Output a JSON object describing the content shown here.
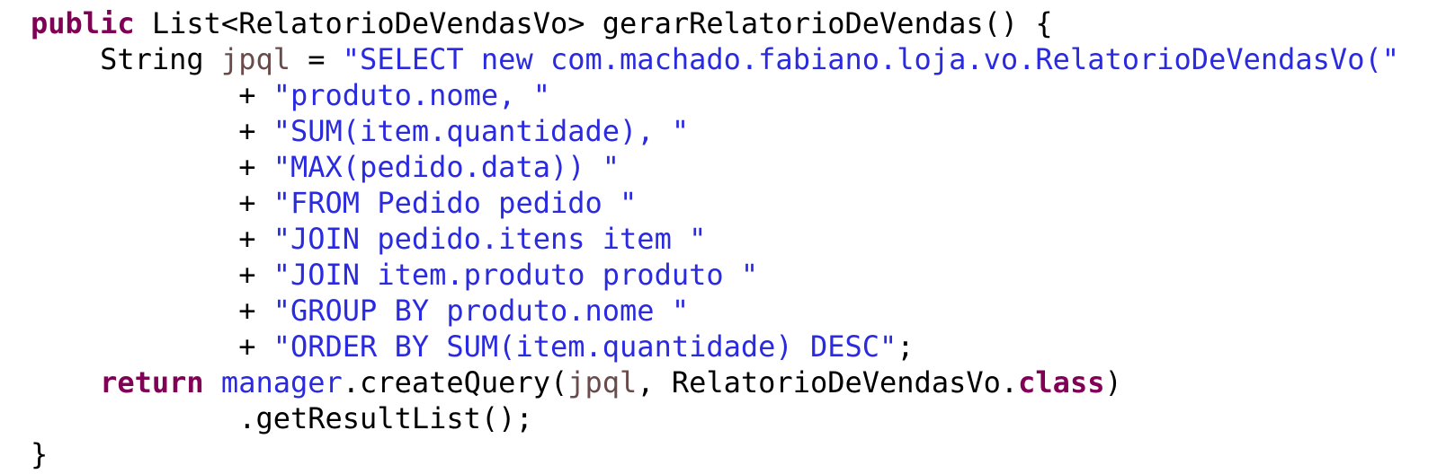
{
  "editor": {
    "language": "Java",
    "background_color": "#FFFFFF",
    "font_family_kind": "monospace",
    "colors": {
      "plain": "#000000",
      "keyword": "#7F0055",
      "string": "#2A2AE0",
      "local_variable": "#6A4A4A",
      "field": "#2A2AE0",
      "operator": "#000000"
    }
  },
  "code": {
    "full_text": "public List<RelatorioDeVendasVo> gerarRelatorioDeVendas() {\n    String jpql = \"SELECT new com.machado.fabiano.loja.vo.RelatorioDeVendasVo(\"\n            + \"produto.nome, \"\n            + \"SUM(item.quantidade), \"\n            + \"MAX(pedido.data)) \"\n            + \"FROM Pedido pedido \"\n            + \"JOIN pedido.itens item \"\n            + \"JOIN item.produto produto \"\n            + \"GROUP BY produto.nome \"\n            + \"ORDER BY SUM(item.quantidade) DESC\";\n    return manager.createQuery(jpql, RelatorioDeVendasVo.class)\n            .getResultList();\n}",
    "lines": [
      {
        "index": 1,
        "tokens": [
          {
            "t": "public",
            "c": "keyword"
          },
          {
            "t": " List<RelatorioDeVendasVo> gerarRelatorioDeVendas() {",
            "c": "plain"
          }
        ]
      },
      {
        "index": 2,
        "tokens": [
          {
            "t": "    String ",
            "c": "plain"
          },
          {
            "t": "jpql",
            "c": "local"
          },
          {
            "t": " = ",
            "c": "plain"
          },
          {
            "t": "\"SELECT new com.machado.fabiano.loja.vo.RelatorioDeVendasVo(\"",
            "c": "string"
          }
        ]
      },
      {
        "index": 3,
        "tokens": [
          {
            "t": "            + ",
            "c": "op"
          },
          {
            "t": "\"produto.nome, \"",
            "c": "string"
          }
        ]
      },
      {
        "index": 4,
        "tokens": [
          {
            "t": "            + ",
            "c": "op"
          },
          {
            "t": "\"SUM(item.quantidade), \"",
            "c": "string"
          }
        ]
      },
      {
        "index": 5,
        "tokens": [
          {
            "t": "            + ",
            "c": "op"
          },
          {
            "t": "\"MAX(pedido.data)) \"",
            "c": "string"
          }
        ]
      },
      {
        "index": 6,
        "tokens": [
          {
            "t": "            + ",
            "c": "op"
          },
          {
            "t": "\"FROM Pedido pedido \"",
            "c": "string"
          }
        ]
      },
      {
        "index": 7,
        "tokens": [
          {
            "t": "            + ",
            "c": "op"
          },
          {
            "t": "\"JOIN pedido.itens item \"",
            "c": "string"
          }
        ]
      },
      {
        "index": 8,
        "tokens": [
          {
            "t": "            + ",
            "c": "op"
          },
          {
            "t": "\"JOIN item.produto produto \"",
            "c": "string"
          }
        ]
      },
      {
        "index": 9,
        "tokens": [
          {
            "t": "            + ",
            "c": "op"
          },
          {
            "t": "\"GROUP BY produto.nome \"",
            "c": "string"
          }
        ]
      },
      {
        "index": 10,
        "tokens": [
          {
            "t": "            + ",
            "c": "op"
          },
          {
            "t": "\"ORDER BY SUM(item.quantidade) DESC\"",
            "c": "string"
          },
          {
            "t": ";",
            "c": "plain"
          }
        ]
      },
      {
        "index": 11,
        "tokens": [
          {
            "t": "    ",
            "c": "plain"
          },
          {
            "t": "return",
            "c": "keyword"
          },
          {
            "t": " ",
            "c": "plain"
          },
          {
            "t": "manager",
            "c": "field"
          },
          {
            "t": ".createQuery(",
            "c": "plain"
          },
          {
            "t": "jpql",
            "c": "local"
          },
          {
            "t": ", RelatorioDeVendasVo.",
            "c": "plain"
          },
          {
            "t": "class",
            "c": "keyword"
          },
          {
            "t": ")",
            "c": "plain"
          }
        ]
      },
      {
        "index": 12,
        "tokens": [
          {
            "t": "            .getResultList();",
            "c": "plain"
          }
        ]
      },
      {
        "index": 13,
        "tokens": [
          {
            "t": "}",
            "c": "plain"
          }
        ]
      }
    ]
  }
}
